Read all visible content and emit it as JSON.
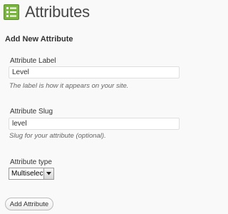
{
  "header": {
    "icon": "attributes-icon",
    "title": "Attributes"
  },
  "form": {
    "section_title": "Add New Attribute",
    "label_field": {
      "label": "Attribute Label",
      "value": "Level",
      "hint": "The label is how it appears on your site."
    },
    "slug_field": {
      "label": "Attribute Slug",
      "value": "level",
      "hint": "Slug for your attribute (optional)."
    },
    "type_field": {
      "label": "Attribute type",
      "selected": "Multiselect"
    },
    "submit_label": "Add Attribute"
  }
}
